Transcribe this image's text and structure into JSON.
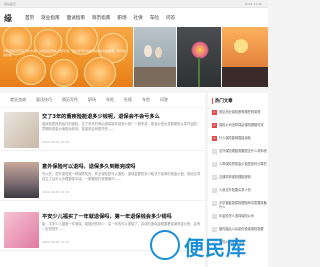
{
  "topbar": {
    "left": "网站首页",
    "right": "2024-11-20"
  },
  "header": {
    "logo": "缘"
  },
  "nav": [
    "首页",
    "就业指南",
    "面试指南",
    "简历指南",
    "职场",
    "社保",
    "车险",
    "问答"
  ],
  "hero": {
    "text": "柠檬到底能否用于切水果，可能会让很多人想不通，我在家里切的时候就常常会遇到，切开后的柠檬……"
  },
  "categories": [
    "就业咨询",
    "面试技巧",
    "简历写作",
    "职场",
    "车险",
    "社保",
    "车险",
    "问答"
  ],
  "posts": [
    {
      "title": "交了3年的重疾险能退多少钱呢，退保会不会亏多么",
      "excerpt": "重疾险是提前给付的保险，交了多长时间后退保能拿回多少钱？一般来讲，现金价值大多数都是从零开始的，早期的现金价值相对较低，退保是会有损失的……",
      "meta": "2024-09-03 12:19"
    },
    {
      "title": "意外保险可以退吗，退保多久到账完成吗",
      "excerpt": "可以的，意外保险是一种保障性的，商业保险是可以退的。退保金额的多少取决于保单的现金价值，保险合同成立之后可以办理退保手续，一般都是在犹豫期内……",
      "meta": "2024-09-05 12:19"
    },
    {
      "title": "平安少儿福买了一年就退保吗，第一年退保钱会多少钱吗",
      "excerpt": "能，平安少儿福第一年退保，能退回的钱少，买一年的可以退保了，具体的退保金额要看保单现金价值，会有一定的损失……",
      "meta": "2024-09-05 12:19"
    }
  ],
  "sidebar": {
    "heading": "热门文章",
    "items": [
      "常见商业保险都有哪些种类呢",
      "保险公司怎样保证保险理赔时效",
      "什么保险能够直接减免",
      "意外保险理赔需要提交什么材料呢",
      "人寿保险的现金价值是如何计算的",
      "交通事故保险理赔规则",
      "人身意外险要买多少份",
      "中华福健康保险理赔申请需要准备什么",
      "年金险怎么选择保险公司",
      "婚内婚后以后如何投保保险需要",
      "保险公司理赔流程"
    ]
  },
  "watermark": {
    "text": "便民库"
  }
}
